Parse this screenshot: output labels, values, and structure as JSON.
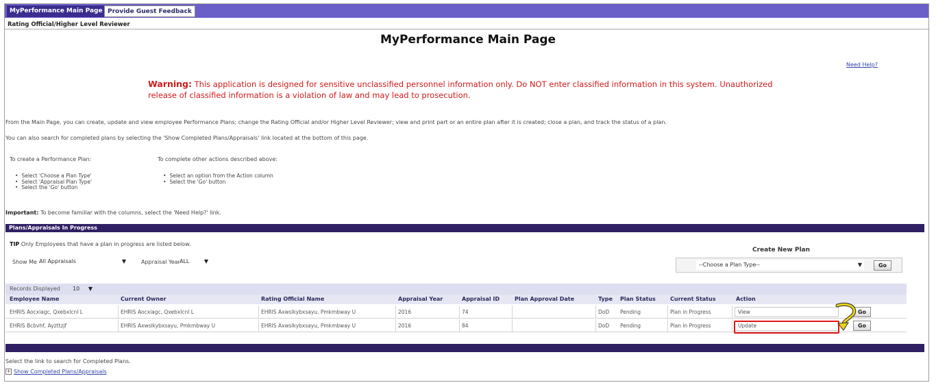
{
  "tabs": [
    {
      "label": "MyPerformance Main Page",
      "active": true
    },
    {
      "label": "Provide Guest Feedback",
      "active": false
    }
  ],
  "role_bar": "Rating Official/Higher Level Reviewer",
  "page_title": "MyPerformance Main Page",
  "need_help": "Need Help?",
  "warning": {
    "label": "Warning:",
    "text": "This application is designed for sensitive unclassified personnel information only. Do NOT enter classified information in this system. Unauthorized release of classified information is a violation of law and may lead to prosecution."
  },
  "intro": {
    "line1": "From the Main Page, you can create, update and view employee Performance Plans; change the Rating Official and/or Higher Level Reviewer; view and print part or an entire plan after it is created; close a plan, and track the status of a plan.",
    "line2": "You can also search for completed plans by selecting the 'Show Completed Plans/Appraisals' link located at the bottom of this page."
  },
  "create_steps": {
    "heading": "To create a Performance Plan:",
    "items": [
      "Select 'Choose a Plan Type'",
      "Select 'Appraisal Plan Type'",
      "Select the 'Go' button"
    ]
  },
  "other_steps": {
    "heading": "To complete other actions described above:",
    "items": [
      "Select an option from the Action column",
      "Select the 'Go' button"
    ]
  },
  "important": {
    "label": "Important:",
    "text": "To become familiar with the columns, select the 'Need Help?' link."
  },
  "section_title": "Plans/Appraisals In Progress",
  "tip": {
    "label": "TIP",
    "text": "Only Employees that have a plan in progress are listed below."
  },
  "filters": {
    "show_me_label": "Show Me",
    "show_me_value": "All Appraisals",
    "year_label": "Appraisal Year",
    "year_value": "ALL"
  },
  "create_new_plan": {
    "title": "Create New Plan",
    "select_value": "--Choose a Plan Type--",
    "go_label": "Go"
  },
  "records": {
    "label": "Records Displayed",
    "value": "10"
  },
  "table": {
    "columns": [
      "Employee Name",
      "Current Owner",
      "Rating Official Name",
      "Appraisal Year",
      "Appraisal ID",
      "Plan Approval Date",
      "Type",
      "Plan Status",
      "Current Status",
      "Action"
    ],
    "rows": [
      {
        "employee": "EHRIS Aocxiagc, Qxebxlcnl L",
        "owner": "EHRIS Aocxiagc, Qxebxlcnl L",
        "rating_official": "EHRIS Axwslkybxsayu, Pmkmbway U",
        "year": "2016",
        "id": "74",
        "approval_date": "",
        "type": "DoD",
        "plan_status": "Pending",
        "current_status": "Plan in Progress",
        "action": "View",
        "go": "Go"
      },
      {
        "employee": "EHRIS Bcbvhf, Ayzttzjf",
        "owner": "EHRIS Axwslkybxsayu, Pmkmbway U",
        "rating_official": "EHRIS Axwslkybxsayu, Pmkmbway U",
        "year": "2016",
        "id": "84",
        "approval_date": "",
        "type": "DoD",
        "plan_status": "Pending",
        "current_status": "Plan in Progress",
        "action": "Update",
        "go": "Go"
      }
    ]
  },
  "footer": {
    "line1": "Select the link to search for Completed Plans.",
    "link": "Show Completed Plans/Appraisals"
  },
  "colors": {
    "tabbar": "#6a5ec9",
    "section_bar": "#2f1f63",
    "warning": "#d21a1a",
    "highlight_box": "#e01515",
    "arrow": "#e8d21a"
  },
  "icons": [
    "plus-box-icon",
    "curved-arrow-icon",
    "dropdown-arrow-icon"
  ]
}
